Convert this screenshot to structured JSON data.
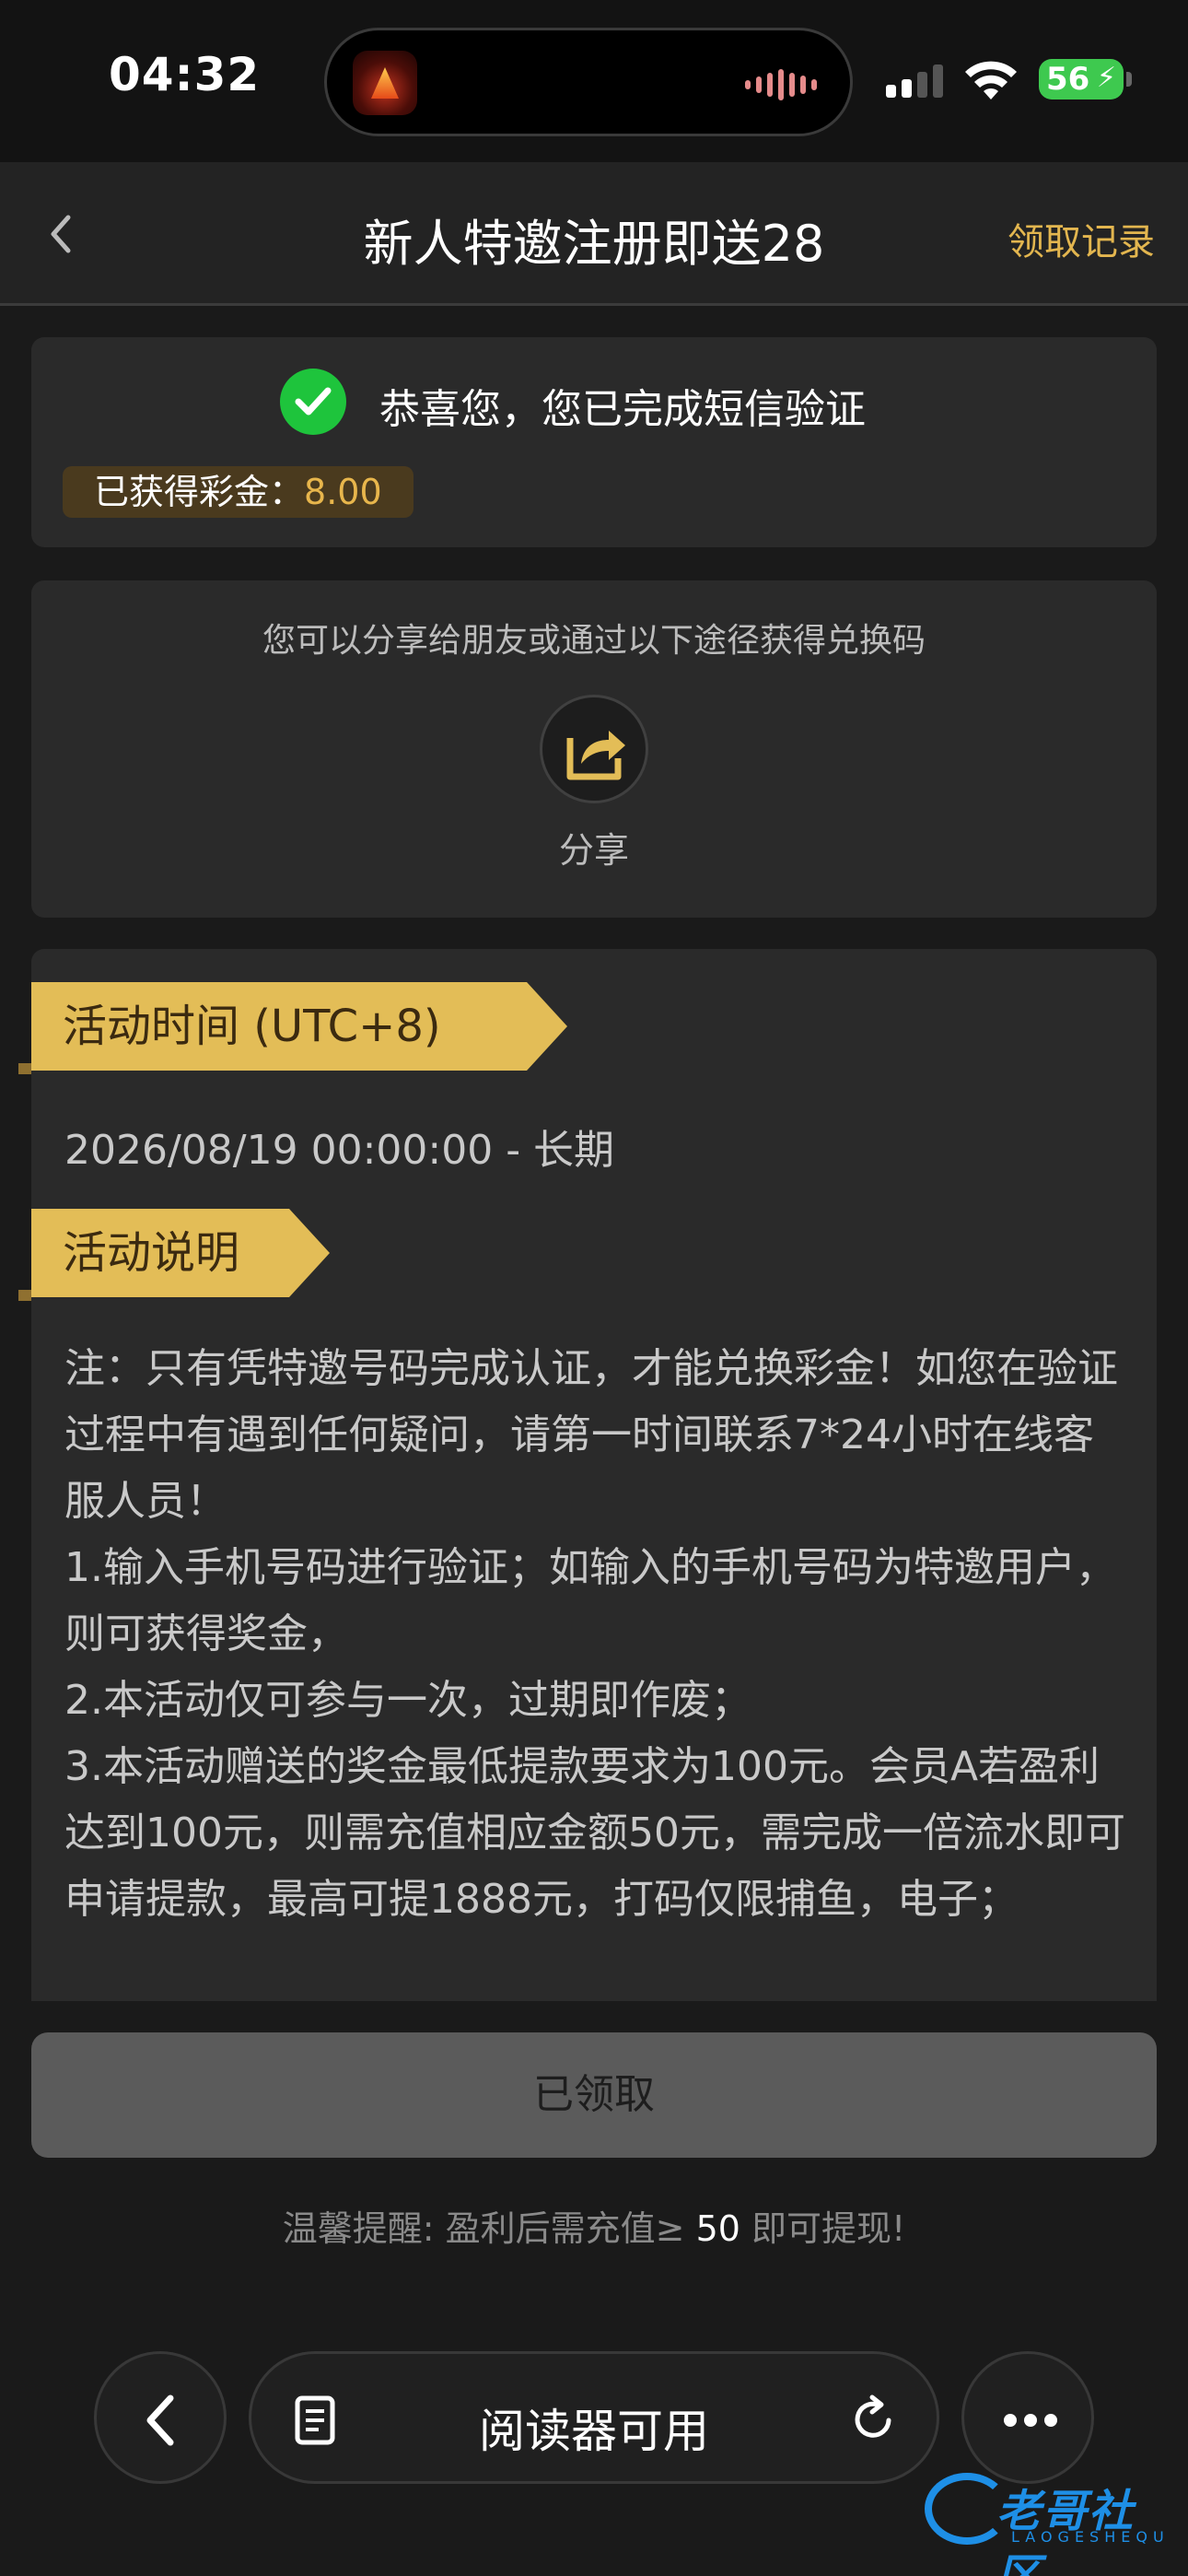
{
  "status_bar": {
    "time": "04:32",
    "battery": "56"
  },
  "nav": {
    "title": "新人特邀注册即送28",
    "record_link": "领取记录"
  },
  "verify_card": {
    "message": "恭喜您，您已完成短信验证",
    "bonus_label": "已获得彩金：",
    "bonus_amount": "8.00"
  },
  "share_card": {
    "hint": "您可以分享给朋友或通过以下途径获得兑换码",
    "share_label": "分享"
  },
  "activity": {
    "time_heading": "活动时间 (UTC+8)",
    "period": "2026/08/19 00:00:00 - 长期",
    "desc_heading": "活动说明",
    "description": [
      "注：只有凭特邀号码完成认证，才能兑换彩金！如您在验证过程中有遇到任何疑问，请第一时间联系7*24小时在线客服人员！",
      "1.输入手机号码进行验证；如输入的手机号码为特邀用户，则可获得奖金，",
      "2.本活动仅可参与一次，过期即作废；",
      "3.本活动赠送的奖金最低提款要求为100元。会员A若盈利达到100元，则需充值相应金额50元，需完成一倍流水即可申请提款，最高可提1888元，打码仅限捕鱼，电子；"
    ]
  },
  "footer": {
    "claim_button": "已领取",
    "tip_prefix": "温馨提醒: 盈利后需充值≥ ",
    "tip_amount": "50",
    "tip_suffix": " 即可提现!"
  },
  "browser": {
    "reader_label": "阅读器可用"
  },
  "watermark": {
    "text": "老哥社区",
    "sub": "LAOGESHEQU"
  },
  "colors": {
    "accent_gold": "#e3bd57",
    "success_green": "#1ec43c",
    "background": "#1a1a1a"
  }
}
